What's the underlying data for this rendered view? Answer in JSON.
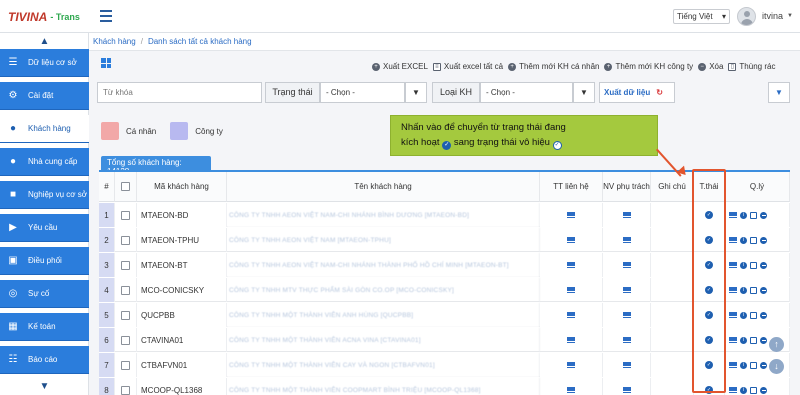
{
  "header": {
    "logo_mark": "TIVINA",
    "logo_sub": "- Trans",
    "language": "Tiếng Việt",
    "username": "itvina"
  },
  "sidebar": {
    "items": [
      {
        "label": "Dữ liệu cơ sở",
        "icon": "list-icon"
      },
      {
        "label": "Cài đặt",
        "icon": "gear-icon"
      },
      {
        "label": "Khách hàng",
        "icon": "user-icon",
        "active": true
      },
      {
        "label": "Nhà cung cấp",
        "icon": "users-icon"
      },
      {
        "label": "Nghiệp vụ cơ sở",
        "icon": "truck-icon"
      },
      {
        "label": "Yêu cầu",
        "icon": "cart-icon"
      },
      {
        "label": "Điều phối",
        "icon": "cube-icon"
      },
      {
        "label": "Sự cố",
        "icon": "life-ring-icon"
      },
      {
        "label": "Kế toán",
        "icon": "calculator-icon"
      },
      {
        "label": "Báo cáo",
        "icon": "table-icon"
      }
    ]
  },
  "breadcrumb": {
    "root": "Khách hàng",
    "current": "Danh sách tất cả khách hàng"
  },
  "toolbar": {
    "actions": [
      {
        "label": "Xuất EXCEL",
        "icon": "export-icon"
      },
      {
        "label": "Xuất excel tất cả",
        "icon": "file-icon"
      },
      {
        "label": "Thêm mới KH cá nhân",
        "icon": "plus-circle-icon"
      },
      {
        "label": "Thêm mới KH công ty",
        "icon": "plus-circle-icon"
      },
      {
        "label": "Xóa",
        "icon": "minus-circle-icon"
      },
      {
        "label": "Thùng rác",
        "icon": "trash-icon"
      }
    ]
  },
  "filter": {
    "keyword_placeholder": "Từ khóa",
    "status_label": "Trạng thái",
    "status_value": "- Chọn -",
    "type_label": "Loại KH",
    "type_value": "- Chọn -",
    "export_label": "Xuất dữ liệu"
  },
  "legend": {
    "personal": {
      "label": "Cá nhân",
      "color": "#f2a8a8"
    },
    "company": {
      "label": "Công ty",
      "color": "#b8b9f0"
    }
  },
  "callout": {
    "line1": "Nhấn vào để chuyển từ trạng thái đang",
    "line2a": "kích hoạt",
    "line2b": "sang trạng thái vô hiệu"
  },
  "count_label": "Tổng số khách hàng: 14128",
  "table": {
    "headers": {
      "num": "#",
      "code": "Mã khách hàng",
      "name": "Tên khách hàng",
      "contact": "TT liên hệ",
      "staff": "NV phụ trách",
      "note": "Ghi chú",
      "status": "T.thái",
      "manage": "Q.lý"
    },
    "rows": [
      {
        "idx": "1",
        "code": "MTAEON-BD",
        "name": "CÔNG TY TNHH AEON VIỆT NAM-CHI NHÁNH BÌNH DƯƠNG [MTAEON-BD]"
      },
      {
        "idx": "2",
        "code": "MTAEON-TPHU",
        "name": "CÔNG TY TNHH AEON VIỆT NAM [MTAEON-TPHU]"
      },
      {
        "idx": "3",
        "code": "MTAEON-BT",
        "name": "CÔNG TY TNHH AEON VIỆT NAM-CHI NHÁNH THÀNH PHỐ HỒ CHÍ MINH [MTAEON-BT]"
      },
      {
        "idx": "4",
        "code": "MCO-CONICSKY",
        "name": "CÔNG TY TNHH MTV THỰC PHẨM SÀI GÒN CO.OP [MCO-CONICSKY]"
      },
      {
        "idx": "5",
        "code": "QUCPBB",
        "name": "CÔNG TY TNHH MỘT THÀNH VIÊN ANH HÙNG [QUCPBB]"
      },
      {
        "idx": "6",
        "code": "CTAVINA01",
        "name": "CÔNG TY TNHH MỘT THÀNH VIÊN ACNA VINA [CTAVINA01]"
      },
      {
        "idx": "7",
        "code": "CTBAFVN01",
        "name": "CÔNG TY TNHH MỘT THÀNH VIÊN CAY VÀ NGON [CTBAFVN01]"
      },
      {
        "idx": "8",
        "code": "MCOOP-QL1368",
        "name": "CÔNG TY TNHH MỘT THÀNH VIÊN COOPMART BÌNH TRIỆU [MCOOP-QL1368]"
      }
    ]
  }
}
